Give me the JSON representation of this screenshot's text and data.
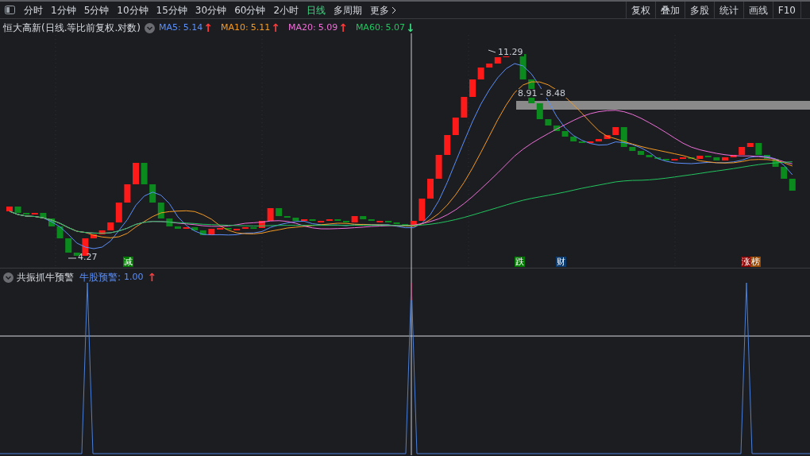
{
  "toolbar": {
    "tabs": [
      {
        "label": "分时",
        "selected": false
      },
      {
        "label": "1分钟",
        "selected": false
      },
      {
        "label": "5分钟",
        "selected": false
      },
      {
        "label": "10分钟",
        "selected": false
      },
      {
        "label": "15分钟",
        "selected": false
      },
      {
        "label": "30分钟",
        "selected": false
      },
      {
        "label": "60分钟",
        "selected": false
      },
      {
        "label": "2小时",
        "selected": false
      },
      {
        "label": "日线",
        "selected": true
      },
      {
        "label": "多周期",
        "selected": false
      },
      {
        "label": "更多",
        "selected": false
      }
    ],
    "actions": [
      "复权",
      "叠加",
      "多股",
      "统计",
      "画线",
      "F10"
    ]
  },
  "legend": {
    "title": "恒大高新(日线.等比前复权.对数)",
    "indicators": [
      {
        "label": "MA5:",
        "value": "5.14",
        "color": "#5b8ff9",
        "arrow": {
          "text": "↑",
          "color": "#ff3b3b"
        }
      },
      {
        "label": "MA10:",
        "value": "5.11",
        "color": "#f59a23",
        "arrow": {
          "text": "↑",
          "color": "#ff3b3b"
        }
      },
      {
        "label": "MA20:",
        "value": "5.09",
        "color": "#ee6fd8",
        "arrow": {
          "text": "↑",
          "color": "#ff3b3b"
        }
      },
      {
        "label": "MA60:",
        "value": "5.07",
        "color": "#22c55e",
        "arrow": {
          "text": "↓",
          "color": "#3ddc84"
        }
      }
    ]
  },
  "chart": {
    "low_label": "4.27",
    "high_label": "11.29",
    "range_label": "8.91 - 8.48",
    "signals": [
      {
        "label": "减",
        "color": "#007a00"
      },
      {
        "label": "跌",
        "color": "#007a00"
      },
      {
        "label": "财",
        "color": "#0b3a6e"
      },
      {
        "label": "涨",
        "color": "#8a0000"
      },
      {
        "label": "榜",
        "color": "#9a4a00"
      }
    ]
  },
  "lower": {
    "title": "共振抓牛预警",
    "indicator": {
      "label": "牛股预警:",
      "value": "1.00",
      "arrow": {
        "text": "↑"
      }
    }
  }
}
